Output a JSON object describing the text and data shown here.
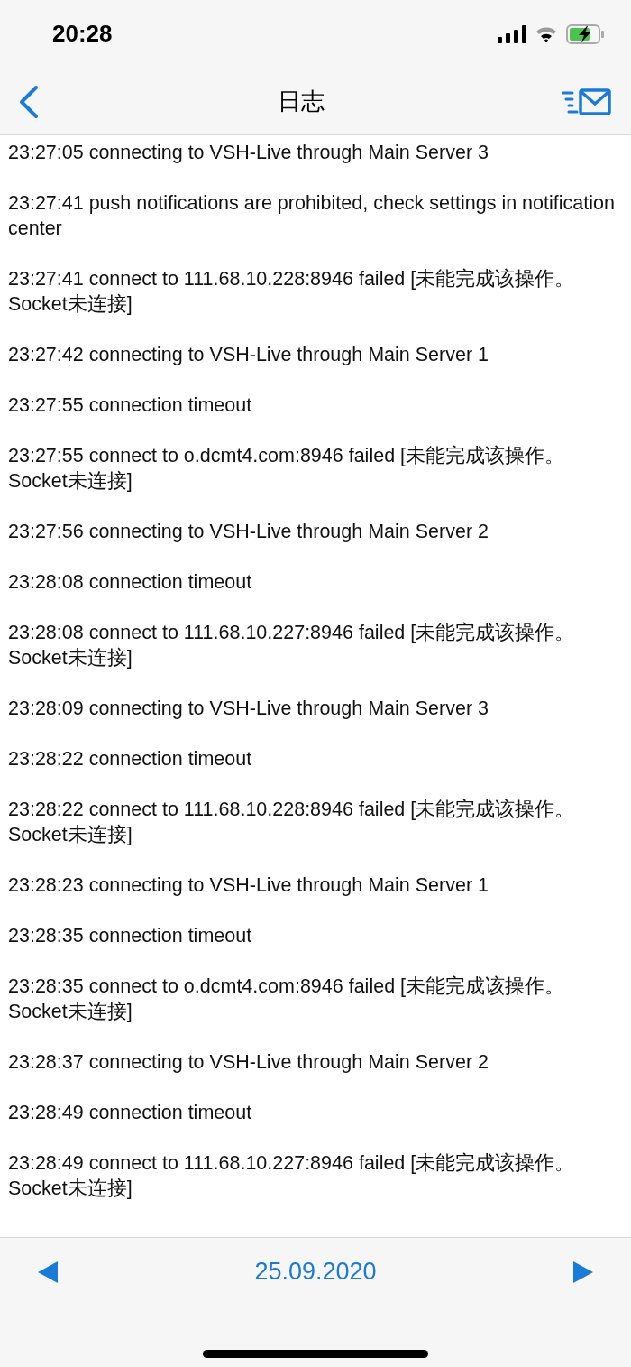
{
  "status_bar": {
    "time": "20:28"
  },
  "nav_bar": {
    "title": "日志"
  },
  "log_entries": [
    "23:27:05 connecting to VSH-Live through Main Server 3",
    "23:27:41 push notifications are prohibited, check settings in notification center",
    "23:27:41 connect to 111.68.10.228:8946 failed [未能完成该操作。Socket未连接]",
    "23:27:42 connecting to VSH-Live through Main Server 1",
    "23:27:55 connection timeout",
    "23:27:55 connect to o.dcmt4.com:8946 failed [未能完成该操作。Socket未连接]",
    "23:27:56 connecting to VSH-Live through Main Server 2",
    "23:28:08 connection timeout",
    "23:28:08 connect to 111.68.10.227:8946 failed [未能完成该操作。Socket未连接]",
    "23:28:09 connecting to VSH-Live through Main Server 3",
    "23:28:22 connection timeout",
    "23:28:22 connect to 111.68.10.228:8946 failed [未能完成该操作。Socket未连接]",
    "23:28:23 connecting to VSH-Live through Main Server 1",
    "23:28:35 connection timeout",
    "23:28:35 connect to o.dcmt4.com:8946 failed [未能完成该操作。Socket未连接]",
    "23:28:37 connecting to VSH-Live through Main Server 2",
    "23:28:49 connection timeout",
    "23:28:49 connect to 111.68.10.227:8946 failed [未能完成该操作。Socket未连接]"
  ],
  "date_bar": {
    "date": "25.09.2020"
  }
}
